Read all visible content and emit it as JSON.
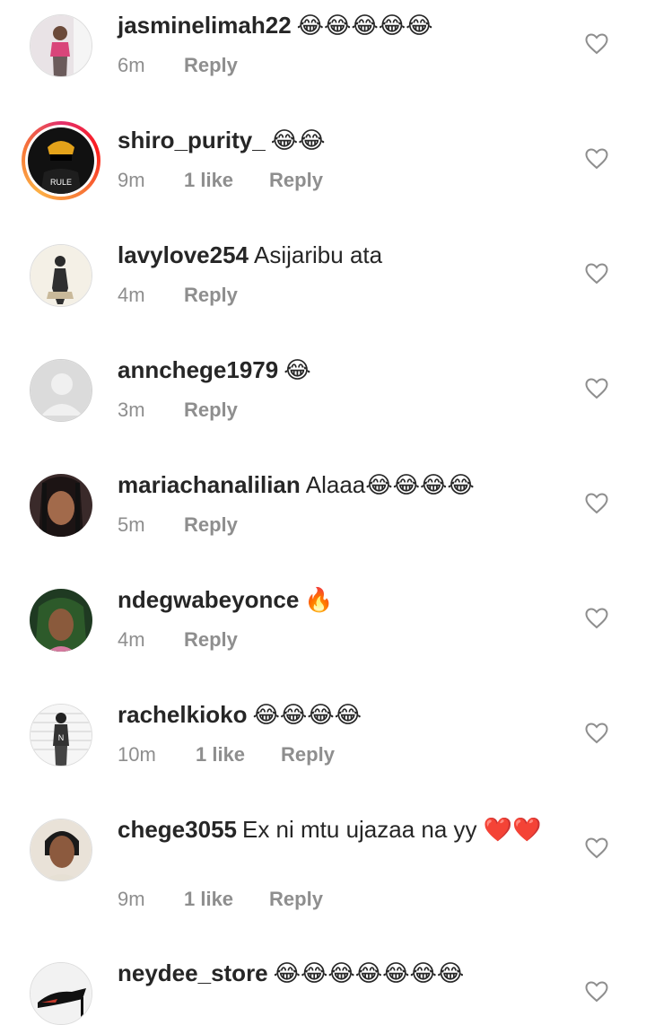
{
  "reply_label": "Reply",
  "comments": [
    {
      "user": "jasminelimah22",
      "text": "😂😂😂😂😂",
      "time": "6m",
      "likes": ""
    },
    {
      "user": "shiro_purity_",
      "text": "😂😂",
      "time": "9m",
      "likes": "1 like"
    },
    {
      "user": "lavylove254",
      "text": "Asijaribu ata",
      "time": "4m",
      "likes": ""
    },
    {
      "user": "annchege1979",
      "text": "😂",
      "time": "3m",
      "likes": ""
    },
    {
      "user": "mariachanalilian",
      "text": "Alaaa😂😂😂😂",
      "time": "5m",
      "likes": ""
    },
    {
      "user": "ndegwabeyonce",
      "text": "🔥",
      "time": "4m",
      "likes": ""
    },
    {
      "user": "rachelkioko",
      "text": "😂😂😂😂",
      "time": "10m",
      "likes": "1 like"
    },
    {
      "user": "chege3055",
      "text": "Ex ni mtu ujazaa na yy ❤️❤️",
      "time": "9m",
      "likes": "1 like"
    },
    {
      "user": "neydee_store",
      "text": "😂😂😂😂😂😂😂",
      "time": "",
      "likes": ""
    }
  ],
  "icons": {
    "like": "heart-outline-icon"
  },
  "colors": {
    "meta": "#8e8e8e",
    "story_ring": "#e1306c"
  }
}
